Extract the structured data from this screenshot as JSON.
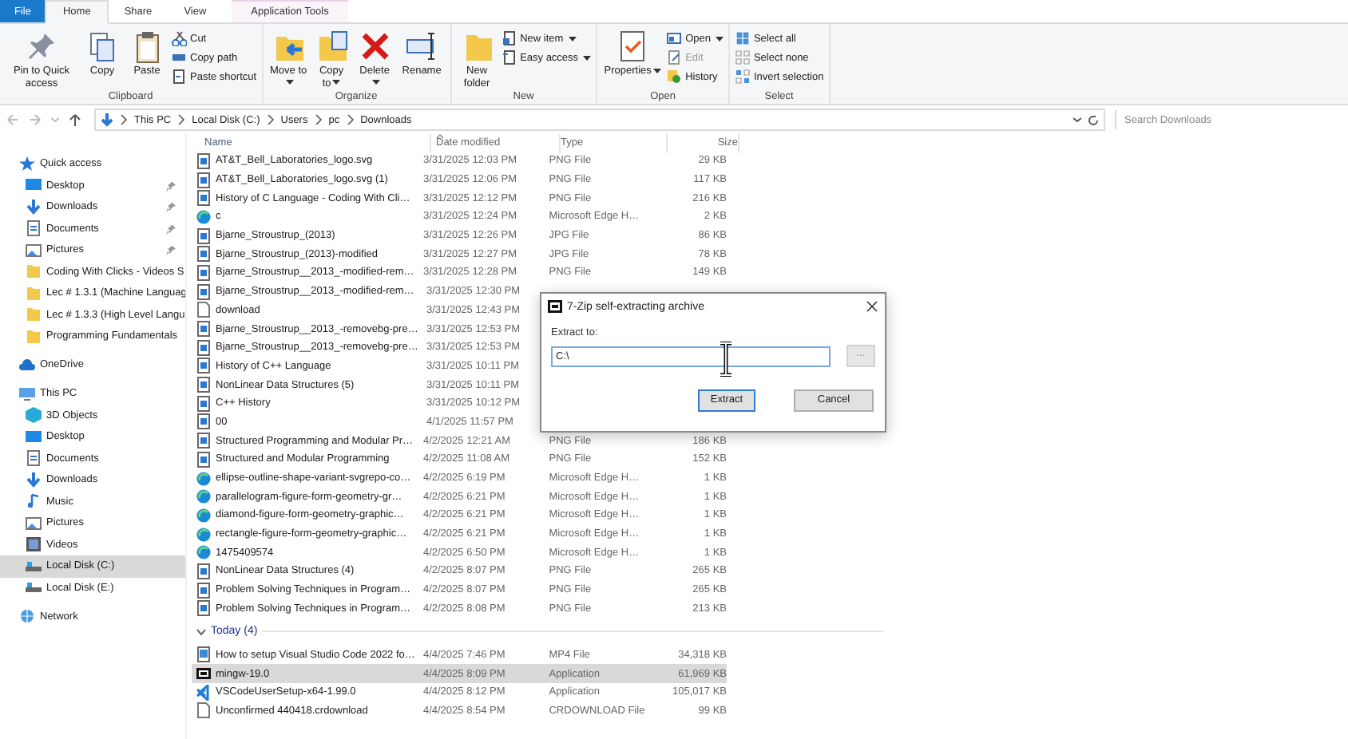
{
  "ribbon": {
    "tabs": [
      {
        "label": "File",
        "kind": "file",
        "selected": false
      },
      {
        "label": "Home",
        "kind": "normal",
        "selected": true
      },
      {
        "label": "Share",
        "kind": "normal",
        "selected": false
      },
      {
        "label": "View",
        "kind": "normal",
        "selected": false
      },
      {
        "label": "Application Tools",
        "kind": "contextual",
        "selected": false
      }
    ],
    "groups": [
      {
        "label": "Clipboard",
        "items": [
          {
            "label": "Pin to Quick access",
            "kind": "large",
            "has_menu": false,
            "disabled": false
          },
          {
            "label": "Copy",
            "kind": "large",
            "has_menu": false,
            "disabled": false
          },
          {
            "label": "Paste",
            "kind": "large",
            "has_menu": false,
            "disabled": false
          },
          {
            "label": "Cut",
            "kind": "small",
            "has_menu": false,
            "disabled": false
          },
          {
            "label": "Copy path",
            "kind": "small",
            "has_menu": false,
            "disabled": false
          },
          {
            "label": "Paste shortcut",
            "kind": "small",
            "has_menu": false,
            "disabled": false
          }
        ]
      },
      {
        "label": "Organize",
        "items": [
          {
            "label": "Move to",
            "kind": "large",
            "has_menu": true,
            "disabled": false
          },
          {
            "label": "Copy to",
            "kind": "large",
            "has_menu": true,
            "disabled": false
          },
          {
            "label": "Delete",
            "kind": "large",
            "has_menu": true,
            "disabled": false
          },
          {
            "label": "Rename",
            "kind": "large",
            "has_menu": false,
            "disabled": false
          }
        ]
      },
      {
        "label": "New",
        "items": [
          {
            "label": "New folder",
            "kind": "large",
            "has_menu": false,
            "disabled": false
          },
          {
            "label": "New item",
            "kind": "small",
            "has_menu": true,
            "disabled": false
          },
          {
            "label": "Easy access",
            "kind": "small",
            "has_menu": true,
            "disabled": false
          }
        ]
      },
      {
        "label": "Open",
        "items": [
          {
            "label": "Properties",
            "kind": "large",
            "has_menu": true,
            "disabled": false
          },
          {
            "label": "Open",
            "kind": "small",
            "has_menu": true,
            "disabled": false
          },
          {
            "label": "Edit",
            "kind": "small",
            "has_menu": false,
            "disabled": true
          },
          {
            "label": "History",
            "kind": "small",
            "has_menu": false,
            "disabled": false
          }
        ]
      },
      {
        "label": "Select",
        "items": [
          {
            "label": "Select all",
            "kind": "small",
            "has_menu": false,
            "disabled": false
          },
          {
            "label": "Select none",
            "kind": "small",
            "has_menu": false,
            "disabled": false
          },
          {
            "label": "Invert selection",
            "kind": "small",
            "has_menu": false,
            "disabled": false
          }
        ]
      }
    ]
  },
  "address_bar": {
    "path": [
      "This PC",
      "Local Disk (C:)",
      "Users",
      "pc",
      "Downloads"
    ],
    "search": {
      "placeholder": "Search Downloads"
    }
  },
  "sidebar": {
    "items": [
      {
        "label": "Quick access",
        "kind": "star",
        "selected": false,
        "children": [
          {
            "label": "Desktop",
            "kind": "desktop",
            "pinned": true,
            "selected": false
          },
          {
            "label": "Downloads",
            "kind": "download",
            "pinned": true,
            "selected": false
          },
          {
            "label": "Documents",
            "kind": "document",
            "pinned": true,
            "selected": false
          },
          {
            "label": "Pictures",
            "kind": "pictures",
            "pinned": true,
            "selected": false
          },
          {
            "label": "Coding With Clicks - Videos S",
            "kind": "folder",
            "pinned": false,
            "selected": false
          },
          {
            "label": "Lec # 1.3.1 (Machine Languag",
            "kind": "folder",
            "pinned": false,
            "selected": false
          },
          {
            "label": "Lec # 1.3.3 (High Level Langu",
            "kind": "folder",
            "pinned": false,
            "selected": false
          },
          {
            "label": "Programming Fundamentals",
            "kind": "folder",
            "pinned": false,
            "selected": false
          }
        ]
      },
      {
        "label": "OneDrive",
        "kind": "cloud",
        "selected": false
      },
      {
        "label": "This PC",
        "kind": "pc",
        "selected": false,
        "children": [
          {
            "label": "3D Objects",
            "kind": "cube",
            "pinned": false,
            "selected": false
          },
          {
            "label": "Desktop",
            "kind": "desktop",
            "pinned": false,
            "selected": false
          },
          {
            "label": "Documents",
            "kind": "document",
            "pinned": false,
            "selected": false
          },
          {
            "label": "Downloads",
            "kind": "download",
            "pinned": false,
            "selected": false
          },
          {
            "label": "Music",
            "kind": "music",
            "pinned": false,
            "selected": false
          },
          {
            "label": "Pictures",
            "kind": "pictures",
            "pinned": false,
            "selected": false
          },
          {
            "label": "Videos",
            "kind": "video",
            "pinned": false,
            "selected": false
          },
          {
            "label": "Local Disk (C:)",
            "kind": "drive",
            "pinned": false,
            "selected": true
          },
          {
            "label": "Local Disk (E:)",
            "kind": "drive",
            "pinned": false,
            "selected": false
          }
        ]
      },
      {
        "label": "Network",
        "kind": "network",
        "selected": false
      }
    ]
  },
  "file_list": {
    "columns": [
      "Name",
      "Date modified",
      "Type",
      "Size"
    ],
    "rows": [
      {
        "name": "AT&T_Bell_Laboratories_logo.svg",
        "date": "3/31/2025 12:03 PM",
        "type": "PNG File",
        "size": "29 KB",
        "kind": "image",
        "selected": false
      },
      {
        "name": "AT&T_Bell_Laboratories_logo.svg (1)",
        "date": "3/31/2025 12:06 PM",
        "type": "PNG File",
        "size": "117 KB",
        "kind": "image",
        "selected": false
      },
      {
        "name": "History of C Language - Coding With Cli…",
        "date": "3/31/2025 12:12 PM",
        "type": "PNG File",
        "size": "216 KB",
        "kind": "image",
        "selected": false
      },
      {
        "name": "c",
        "date": "3/31/2025 12:24 PM",
        "type": "Microsoft Edge H…",
        "size": "2 KB",
        "kind": "edge",
        "selected": false
      },
      {
        "name": "Bjarne_Stroustrup_(2013)",
        "date": "3/31/2025 12:26 PM",
        "type": "JPG File",
        "size": "86 KB",
        "kind": "image",
        "selected": false
      },
      {
        "name": "Bjarne_Stroustrup_(2013)-modified",
        "date": "3/31/2025 12:27 PM",
        "type": "JPG File",
        "size": "78 KB",
        "kind": "image",
        "selected": false
      },
      {
        "name": "Bjarne_Stroustrup__2013_-modified-rem…",
        "date": "3/31/2025 12:28 PM",
        "type": "PNG File",
        "size": "149 KB",
        "kind": "image",
        "selected": false
      },
      {
        "name": "Bjarne_Stroustrup__2013_-modified-rem…",
        "date": "3/31/2025 12:30 PM",
        "kind": "image",
        "selected": false
      },
      {
        "name": "download",
        "date": "3/31/2025 12:43 PM",
        "kind": "blank",
        "selected": false
      },
      {
        "name": "Bjarne_Stroustrup__2013_-removebg-pre…",
        "date": "3/31/2025 12:53 PM",
        "kind": "image",
        "selected": false
      },
      {
        "name": "Bjarne_Stroustrup__2013_-removebg-pre…",
        "date": "3/31/2025 12:53 PM",
        "kind": "image",
        "selected": false
      },
      {
        "name": "History of C++ Language",
        "date": "3/31/2025 10:11 PM",
        "kind": "image",
        "selected": false
      },
      {
        "name": "NonLinear Data Structures (5)",
        "date": "3/31/2025 10:11 PM",
        "kind": "image",
        "selected": false
      },
      {
        "name": "C++ History",
        "date": "3/31/2025 10:12 PM",
        "kind": "image",
        "selected": false
      },
      {
        "name": "00",
        "date": "4/1/2025 11:57 PM",
        "kind": "image",
        "selected": false
      },
      {
        "name": "Structured Programming and Modular Pr…",
        "date": "4/2/2025 12:21 AM",
        "type": "PNG File",
        "size": "186 KB",
        "kind": "image",
        "selected": false
      },
      {
        "name": "Structured and Modular Programming",
        "date": "4/2/2025 11:08 AM",
        "type": "PNG File",
        "size": "152 KB",
        "kind": "image",
        "selected": false
      },
      {
        "name": "ellipse-outline-shape-variant-svgrepo-co…",
        "date": "4/2/2025 6:19 PM",
        "type": "Microsoft Edge H…",
        "size": "1 KB",
        "kind": "edge",
        "selected": false
      },
      {
        "name": "parallelogram-figure-form-geometry-gr…",
        "date": "4/2/2025 6:21 PM",
        "type": "Microsoft Edge H…",
        "size": "1 KB",
        "kind": "edge",
        "selected": false
      },
      {
        "name": "diamond-figure-form-geometry-graphic…",
        "date": "4/2/2025 6:21 PM",
        "type": "Microsoft Edge H…",
        "size": "1 KB",
        "kind": "edge",
        "selected": false
      },
      {
        "name": "rectangle-figure-form-geometry-graphic…",
        "date": "4/2/2025 6:21 PM",
        "type": "Microsoft Edge H…",
        "size": "1 KB",
        "kind": "edge",
        "selected": false
      },
      {
        "name": "1475409574",
        "date": "4/2/2025 6:50 PM",
        "type": "Microsoft Edge H…",
        "size": "1 KB",
        "kind": "edge",
        "selected": false
      },
      {
        "name": "NonLinear Data Structures (4)",
        "date": "4/2/2025 8:07 PM",
        "type": "PNG File",
        "size": "265 KB",
        "kind": "image",
        "selected": false
      },
      {
        "name": "Problem Solving Techniques in Program…",
        "date": "4/2/2025 8:07 PM",
        "type": "PNG File",
        "size": "265 KB",
        "kind": "image",
        "selected": false
      },
      {
        "name": "Problem Solving Techniques in Program…",
        "date": "4/2/2025 8:08 PM",
        "type": "PNG File",
        "size": "213 KB",
        "kind": "image",
        "selected": false
      }
    ],
    "groups": [
      {
        "label": "Today (4)",
        "expanded": true,
        "rows": [
          {
            "name": "How to setup Visual Studio Code 2022 fo…",
            "date": "4/4/2025 7:46 PM",
            "type": "MP4 File",
            "size": "34,318 KB",
            "kind": "video",
            "selected": false
          },
          {
            "name": "mingw-19.0",
            "date": "4/4/2025 8:09 PM",
            "type": "Application",
            "size": "61,969 KB",
            "kind": "archive",
            "selected": true
          },
          {
            "name": "VSCodeUserSetup-x64-1.99.0",
            "date": "4/4/2025 8:12 PM",
            "type": "Application",
            "size": "105,017 KB",
            "kind": "vscode",
            "selected": false
          },
          {
            "name": "Unconfirmed 440418.crdownload",
            "date": "4/4/2025 8:54 PM",
            "type": "CRDOWNLOAD File",
            "size": "99 KB",
            "kind": "blank",
            "selected": false
          }
        ]
      }
    ]
  },
  "dialog": {
    "title": "7-Zip self-extracting archive",
    "label": "Extract to:",
    "value": "C:\\",
    "browse_button": "...",
    "buttons": [
      {
        "label": "Extract",
        "kind": "default"
      },
      {
        "label": "Cancel",
        "kind": "normal"
      }
    ]
  }
}
